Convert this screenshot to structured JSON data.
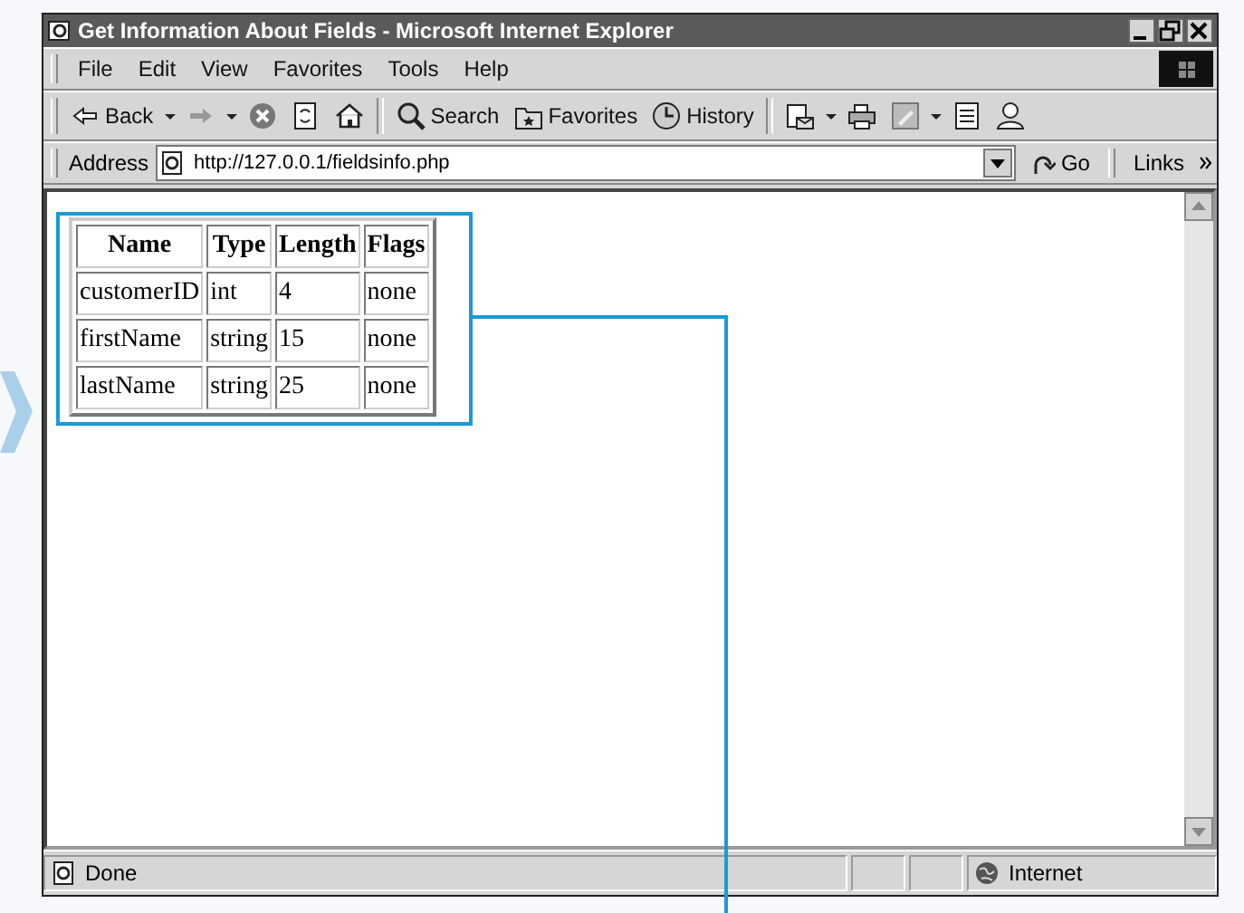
{
  "window": {
    "title": "Get Information About Fields - Microsoft Internet Explorer"
  },
  "menu": [
    "File",
    "Edit",
    "View",
    "Favorites",
    "Tools",
    "Help"
  ],
  "toolbar": {
    "back": "Back",
    "search": "Search",
    "favorites": "Favorites",
    "history": "History"
  },
  "address_bar": {
    "label": "Address",
    "url": "http://127.0.0.1/fieldsinfo.php",
    "go": "Go",
    "links": "Links"
  },
  "table": {
    "columns": [
      "Name",
      "Type",
      "Length",
      "Flags"
    ],
    "rows": [
      [
        "customerID",
        "int",
        "4",
        "none"
      ],
      [
        "firstName",
        "string",
        "15",
        "none"
      ],
      [
        "lastName",
        "string",
        "25",
        "none"
      ]
    ]
  },
  "status_bar": {
    "text": "Done",
    "zone": "Internet"
  }
}
